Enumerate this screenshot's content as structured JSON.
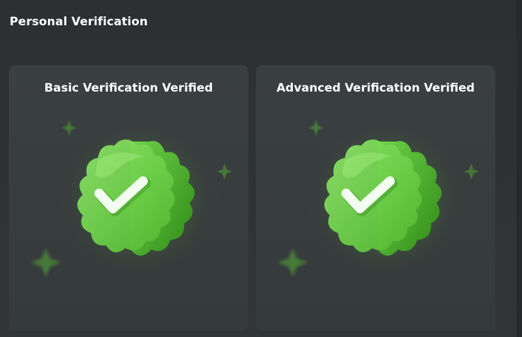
{
  "section": {
    "title": "Personal Verification"
  },
  "cards": [
    {
      "title": "Basic Verification Verified",
      "icon": "verified-badge-icon"
    },
    {
      "title": "Advanced Verification Verified",
      "icon": "verified-badge-icon"
    }
  ],
  "colors": {
    "background": "#2e3233",
    "card": "#393e40",
    "badge_green": "#6fd24a",
    "badge_dark_green": "#3f9a22",
    "sparkle_green": "#4e8e3a"
  }
}
